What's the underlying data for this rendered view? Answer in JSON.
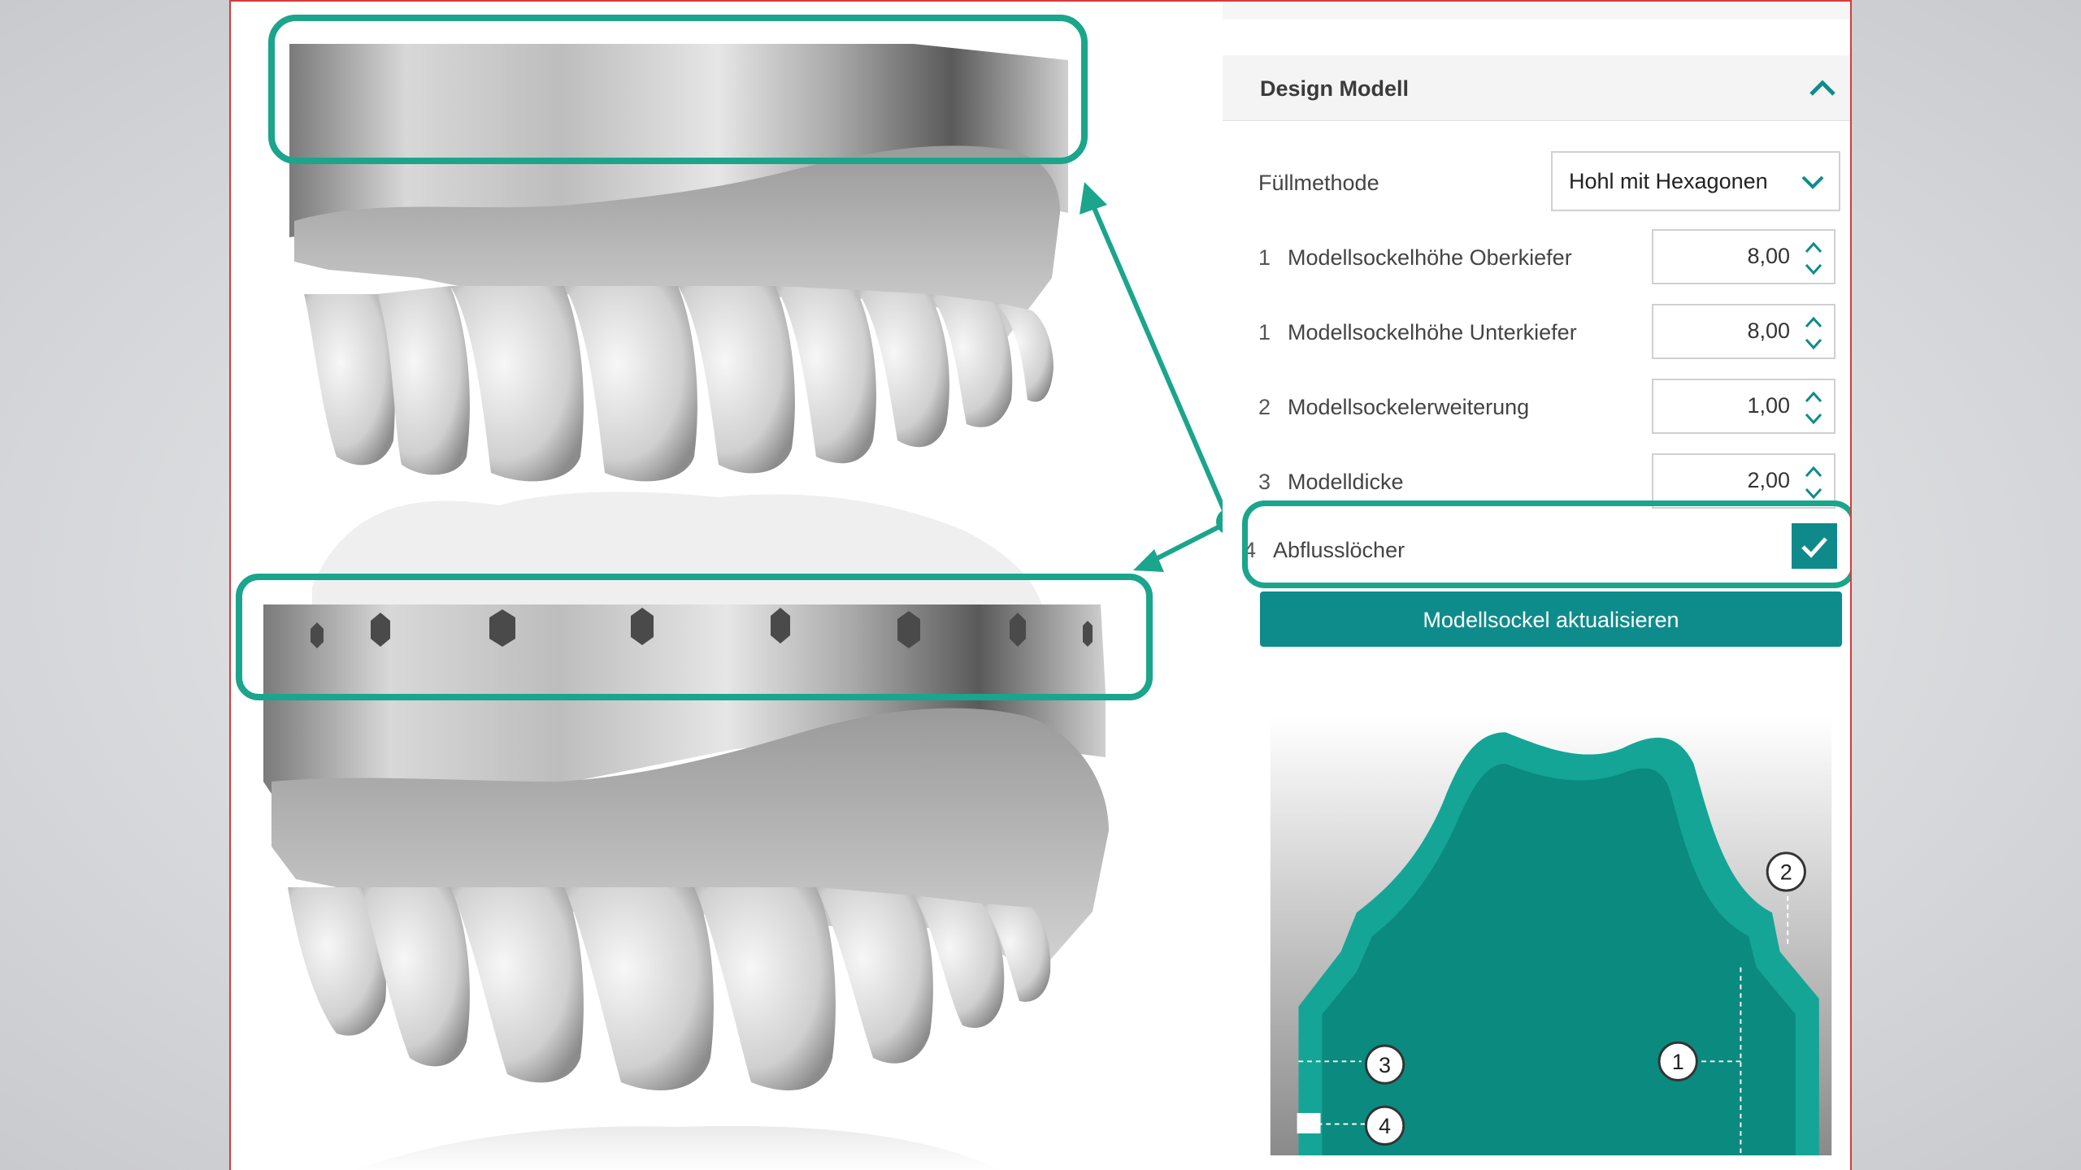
{
  "panel": {
    "section_title": "Design Modell",
    "fill_method": {
      "label": "Füllmethode",
      "value": "Hohl mit Hexagonen"
    },
    "fields": [
      {
        "num": "1",
        "label": "Modellsockelhöhe Oberkiefer",
        "value": "8,00"
      },
      {
        "num": "1",
        "label": "Modellsockelhöhe Unterkiefer",
        "value": "8,00"
      },
      {
        "num": "2",
        "label": "Modellsockelerweiterung",
        "value": "1,00"
      },
      {
        "num": "3",
        "label": "Modelldicke",
        "value": "2,00"
      }
    ],
    "drain_holes": {
      "num": "4",
      "label": "Abflusslöcher",
      "checked": true
    },
    "update_button": "Modellsockel aktualisieren"
  },
  "diagram": {
    "callouts": [
      "2",
      "1",
      "3",
      "4"
    ]
  },
  "colors": {
    "accent": "#0e8c8c",
    "highlight": "#1aa58c",
    "frame_border": "#d83a3a"
  }
}
